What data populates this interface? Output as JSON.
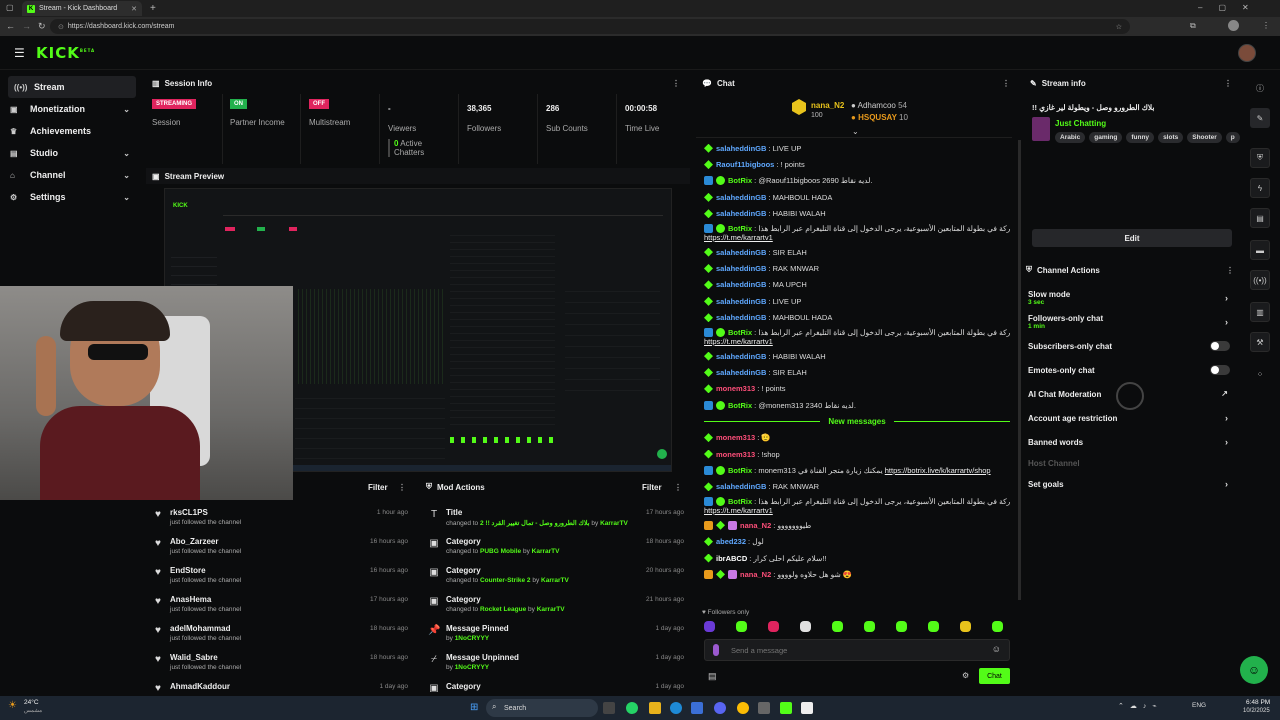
{
  "browser": {
    "tab_title": "Stream - Kick Dashboard",
    "url": "https://dashboard.kick.com/stream",
    "new_tab": "+"
  },
  "brand": {
    "logo": "KICK",
    "logo_sup": "BETA",
    "accent": "#53fc18"
  },
  "sidebar": {
    "items": [
      {
        "label": "Stream",
        "icon": "broadcast-icon",
        "active": true
      },
      {
        "label": "Monetization",
        "icon": "wallet-icon",
        "chevron": true
      },
      {
        "label": "Achievements",
        "icon": "trophy-icon"
      },
      {
        "label": "Studio",
        "icon": "studio-icon",
        "chevron": true
      },
      {
        "label": "Channel",
        "icon": "channel-icon",
        "chevron": true
      },
      {
        "label": "Settings",
        "icon": "gear-icon",
        "chevron": true
      }
    ]
  },
  "session": {
    "title": "Session Info",
    "status_badges": [
      {
        "badge": "STREAMING",
        "label": "Session",
        "color": "#e0245e"
      },
      {
        "badge": "ON",
        "label": "Partner Income",
        "color": "#22b14c"
      },
      {
        "badge": "OFF",
        "label": "Multistream",
        "color": "#e0245e"
      }
    ],
    "stats": [
      {
        "value": "-",
        "label": "Viewers"
      },
      {
        "value": "38,365",
        "label": "Followers"
      },
      {
        "value": "286",
        "label": "Sub Counts"
      },
      {
        "value": "00:00:58",
        "label": "Time Live"
      }
    ],
    "active_count": "0",
    "active_label": "Active",
    "chatters_label": "Chatters"
  },
  "preview": {
    "title": "Stream Preview"
  },
  "activity_feed": {
    "filter_label": "Filter",
    "items": [
      {
        "user": "rksCL1PS",
        "text": "just followed the channel",
        "time": "1 hour ago"
      },
      {
        "user": "Abo_Zarzeer",
        "text": "just followed the channel",
        "time": "16 hours ago"
      },
      {
        "user": "EndStore",
        "text": "just followed the channel",
        "time": "16 hours ago"
      },
      {
        "user": "AnasHema",
        "text": "just followed the channel",
        "time": "17 hours ago"
      },
      {
        "user": "adelMohammad",
        "text": "just followed the channel",
        "time": "18 hours ago"
      },
      {
        "user": "Walid_Sabre",
        "text": "just followed the channel",
        "time": "18 hours ago"
      },
      {
        "user": "AhmadKaddour",
        "text": "",
        "time": "1 day ago"
      }
    ]
  },
  "mod_actions": {
    "title": "Mod Actions",
    "filter_label": "Filter",
    "items": [
      {
        "title": "Title",
        "pre": "changed to",
        "value": "2 !! بلاك الطرورو وصل - تمال تغيير القرد",
        "by": "KarrarTV",
        "time": "17 hours ago",
        "icon": "text-icon"
      },
      {
        "title": "Category",
        "pre": "changed to",
        "value": "PUBG Mobile",
        "by": "KarrarTV",
        "time": "18 hours ago",
        "icon": "category-icon"
      },
      {
        "title": "Category",
        "pre": "changed to",
        "value": "Counter-Strike 2",
        "by": "KarrarTV",
        "time": "20 hours ago",
        "icon": "category-icon"
      },
      {
        "title": "Category",
        "pre": "changed to",
        "value": "Rocket League",
        "by": "KarrarTV",
        "time": "21 hours ago",
        "icon": "category-icon"
      },
      {
        "title": "Message Pinned",
        "pre": "by",
        "value": "",
        "by": "1NoCRYYY",
        "time": "1 day ago",
        "icon": "pin-icon"
      },
      {
        "title": "Message Unpinned",
        "pre": "by",
        "value": "",
        "by": "1NoCRYYY",
        "time": "1 day ago",
        "icon": "unpin-icon"
      },
      {
        "title": "Category",
        "pre": "",
        "value": "",
        "by": "",
        "time": "1 day ago",
        "icon": "category-icon"
      }
    ]
  },
  "chat": {
    "title": "Chat",
    "leaderboard": [
      {
        "name": "nana_N2",
        "points": "100",
        "color": "#e8c31c"
      },
      {
        "name": "Adhamcoo",
        "points": "54",
        "color": "#bbbbbb"
      },
      {
        "name": "HSQUSAY",
        "points": "10",
        "color": "#e89a1c"
      }
    ],
    "messages": [
      {
        "user": "salaheddinGB",
        "color": "#5fa8ff",
        "text": ": LIVE UP"
      },
      {
        "user": "Raouf11bigboos",
        "color": "#5fa8ff",
        "text": ": ! points"
      },
      {
        "user": "BotRix",
        "color": "#53fc18",
        "text": ": @Raouf11bigboos 2690 لديه نقاط."
      },
      {
        "user": "salaheddinGB",
        "color": "#5fa8ff",
        "text": ": MAHBOUL HADA"
      },
      {
        "user": "salaheddinGB",
        "color": "#5fa8ff",
        "text": ": HABIBI WALAH"
      },
      {
        "user": "BotRix",
        "color": "#53fc18",
        "text": ": للمشاركة في بطولة المتابعين الأسبوعية، يرجى الدخول إلى قناة التليغرام عبر الرابط هذا ||",
        "link": "https://t.me/karrartv1"
      },
      {
        "user": "salaheddinGB",
        "color": "#5fa8ff",
        "text": ": SIR ELAH"
      },
      {
        "user": "salaheddinGB",
        "color": "#5fa8ff",
        "text": ": RAK MNWAR"
      },
      {
        "user": "salaheddinGB",
        "color": "#5fa8ff",
        "text": ": MA UPCH"
      },
      {
        "user": "salaheddinGB",
        "color": "#5fa8ff",
        "text": ": LIVE UP"
      },
      {
        "user": "salaheddinGB",
        "color": "#5fa8ff",
        "text": ": MAHBOUL HADA"
      },
      {
        "user": "BotRix",
        "color": "#53fc18",
        "text": ": للمشاركة في بطولة المتابعين الأسبوعية، يرجى الدخول إلى قناة التليغرام عبر الرابط هذا ||",
        "link": "https://t.me/karrartv1"
      },
      {
        "user": "salaheddinGB",
        "color": "#5fa8ff",
        "text": ": HABIBI WALAH"
      },
      {
        "user": "salaheddinGB",
        "color": "#5fa8ff",
        "text": ": SIR ELAH"
      },
      {
        "user": "monem313",
        "color": "#ff4f7a",
        "text": ": ! points"
      },
      {
        "user": "BotRix",
        "color": "#53fc18",
        "text": ": @monem313 2340 لديه نقاط."
      }
    ],
    "new_messages_label": "New messages",
    "messages_after": [
      {
        "user": "monem313",
        "color": "#ff4f7a",
        "text": ": 🫡"
      },
      {
        "user": "monem313",
        "color": "#ff4f7a",
        "text": ": !shop"
      },
      {
        "user": "BotRix",
        "color": "#53fc18",
        "text": ": monem313 يمكنك زيارة متجر القناة في ",
        "link": "https://botrix.live/k/karrartv/shop"
      },
      {
        "user": "salaheddinGB",
        "color": "#5fa8ff",
        "text": ": RAK MNWAR"
      },
      {
        "user": "BotRix",
        "color": "#53fc18",
        "text": ": للمشاركة في بطولة المتابعين الأسبوعية، يرجى الدخول إلى قناة التليغرام عبر الرابط هذا ||",
        "link": "https://t.me/karrartv1"
      },
      {
        "user": "nana_N2",
        "color": "#ff4f7a",
        "text": ": طيووووووو"
      },
      {
        "user": "abed232",
        "color": "#5fa8ff",
        "text": ": لول"
      },
      {
        "user": "ibrABCD",
        "color": "#ffffff",
        "text": ": سلام عليكم احلى كرار!!"
      },
      {
        "user": "nana_N2",
        "color": "#ff4f7a",
        "text": ": شو هل حلاوه ولوووو 😍"
      }
    ],
    "followers_only": "Followers only",
    "input_placeholder": "Send a message",
    "send_label": "Chat"
  },
  "stream_info": {
    "title": "Stream info",
    "stream_title": "!! بلاك الطرورو وصل - ويطولة لير غازي",
    "category": "Just Chatting",
    "tags": [
      "Arabic",
      "gaming",
      "funny",
      "slots",
      "Shooter",
      "p"
    ],
    "edit_label": "Edit"
  },
  "channel_actions": {
    "title": "Channel Actions",
    "items": [
      {
        "label": "Slow mode",
        "sub": "3 sec",
        "control": "chevron"
      },
      {
        "label": "Followers-only chat",
        "sub": "1 min",
        "control": "chevron"
      },
      {
        "label": "Subscribers-only chat",
        "sub": "",
        "control": "toggle"
      },
      {
        "label": "Emotes-only chat",
        "sub": "",
        "control": "toggle"
      },
      {
        "label": "AI Chat Moderation",
        "sub": "",
        "control": "external"
      },
      {
        "label": "Account age restriction",
        "sub": "",
        "control": "chevron"
      },
      {
        "label": "Banned words",
        "sub": "",
        "control": "chevron"
      },
      {
        "label": "Host Channel",
        "sub": "",
        "control": "disabled"
      },
      {
        "label": "Set goals",
        "sub": "",
        "control": "chevron"
      }
    ]
  },
  "taskbar": {
    "weather": "24°C",
    "weather_sub": "مشمس",
    "search": "Search",
    "lang": "ENG",
    "time": "6:48 PM",
    "date": "10/2/2025"
  }
}
